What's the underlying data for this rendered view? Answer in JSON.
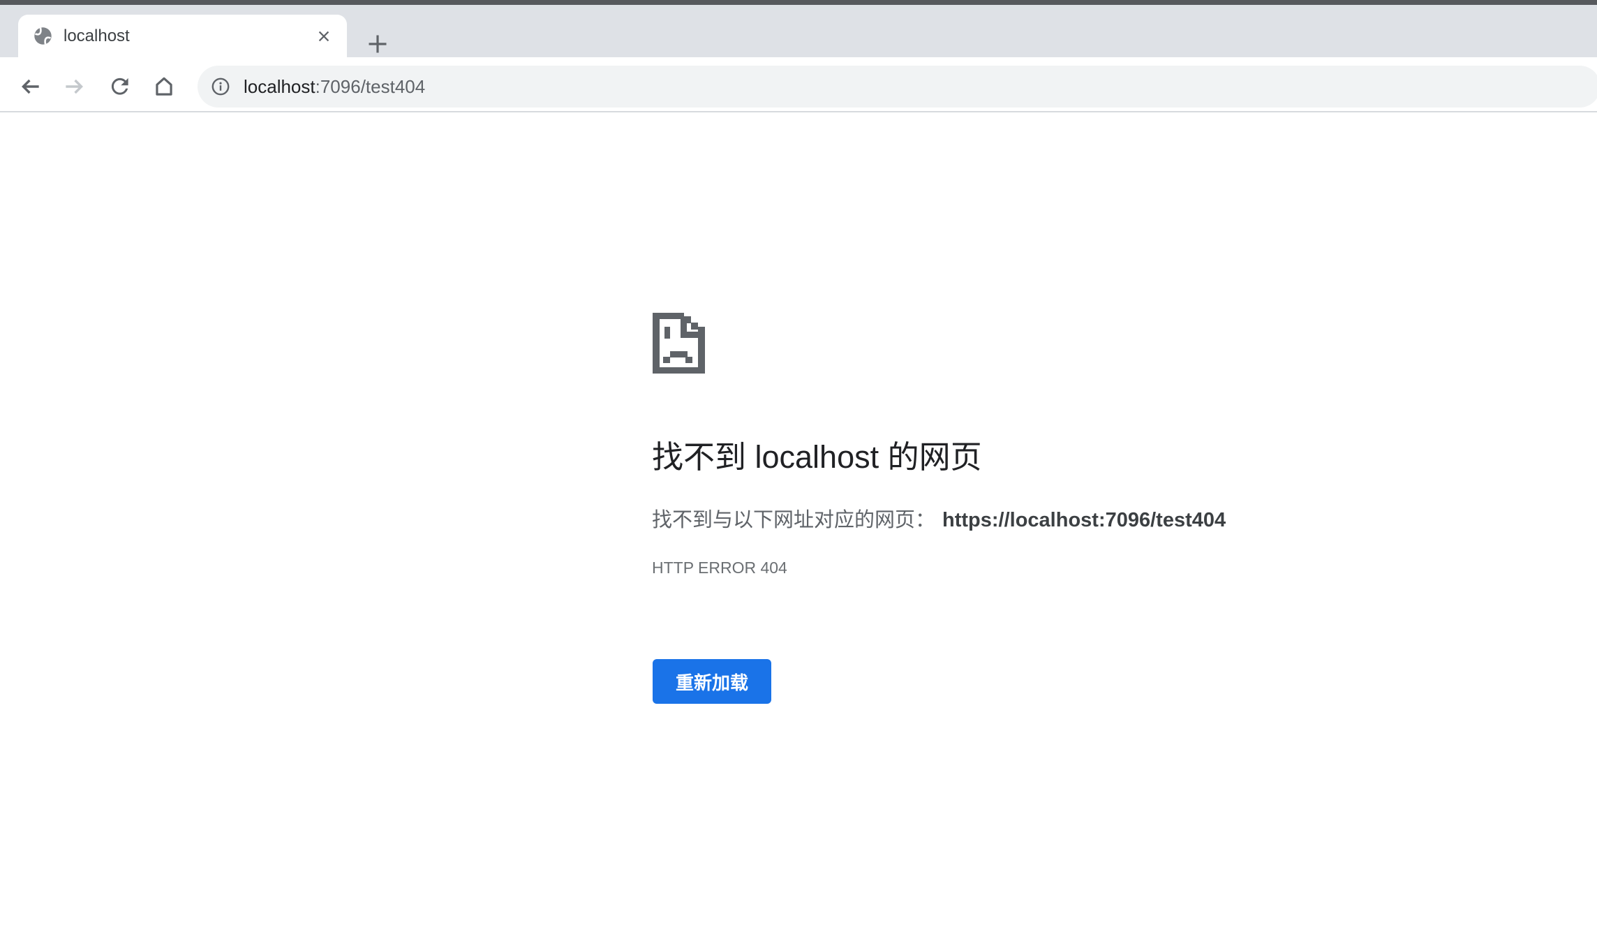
{
  "browser": {
    "tab": {
      "title": "localhost"
    },
    "toolbar": {
      "url_host": "localhost",
      "url_path": ":7096/test404"
    }
  },
  "page": {
    "heading": "找不到 localhost 的网页",
    "message": "找不到与以下网址对应的网页：",
    "requested_url": "https://localhost:7096/test404",
    "error_code": "HTTP ERROR 404",
    "reload_button_label": "重新加载"
  },
  "icons": {
    "globe-favicon": "generic gray globe",
    "close-icon": "×",
    "new-tab-icon": "+",
    "back-icon": "←",
    "forward-icon": "→ (disabled)",
    "reload-icon": "↻",
    "home-icon": "⌂",
    "info-icon": "ⓘ",
    "sad-file-icon": "pixelated document with sad face"
  },
  "colors": {
    "accent_blue": "#1a73e8",
    "tab_strip_bg": "#dee1e6",
    "omnibox_bg": "#f1f3f4",
    "icon_gray": "#5f6368",
    "disabled_icon_gray": "#c4c8cc",
    "text_dark": "#202124",
    "text_gray": "#5f6368",
    "window_top_strip": "#57595d"
  }
}
